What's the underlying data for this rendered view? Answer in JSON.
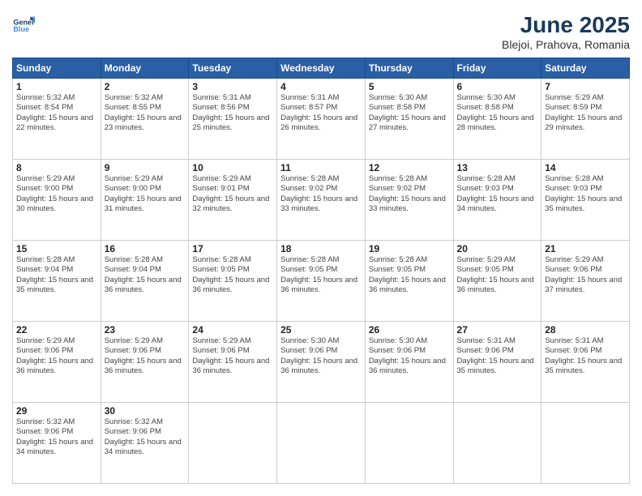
{
  "app": {
    "name": "GeneralBlue",
    "name_part1": "General",
    "name_part2": "Blue"
  },
  "header": {
    "month_year": "June 2025",
    "location": "Blejoi, Prahova, Romania"
  },
  "days_of_week": [
    "Sunday",
    "Monday",
    "Tuesday",
    "Wednesday",
    "Thursday",
    "Friday",
    "Saturday"
  ],
  "weeks": [
    [
      {
        "day": 1,
        "sunrise": "5:32 AM",
        "sunset": "8:54 PM",
        "daylight": "15 hours and 22 minutes."
      },
      {
        "day": 2,
        "sunrise": "5:32 AM",
        "sunset": "8:55 PM",
        "daylight": "15 hours and 23 minutes."
      },
      {
        "day": 3,
        "sunrise": "5:31 AM",
        "sunset": "8:56 PM",
        "daylight": "15 hours and 25 minutes."
      },
      {
        "day": 4,
        "sunrise": "5:31 AM",
        "sunset": "8:57 PM",
        "daylight": "15 hours and 26 minutes."
      },
      {
        "day": 5,
        "sunrise": "5:30 AM",
        "sunset": "8:58 PM",
        "daylight": "15 hours and 27 minutes."
      },
      {
        "day": 6,
        "sunrise": "5:30 AM",
        "sunset": "8:58 PM",
        "daylight": "15 hours and 28 minutes."
      },
      {
        "day": 7,
        "sunrise": "5:29 AM",
        "sunset": "8:59 PM",
        "daylight": "15 hours and 29 minutes."
      }
    ],
    [
      {
        "day": 8,
        "sunrise": "5:29 AM",
        "sunset": "9:00 PM",
        "daylight": "15 hours and 30 minutes."
      },
      {
        "day": 9,
        "sunrise": "5:29 AM",
        "sunset": "9:00 PM",
        "daylight": "15 hours and 31 minutes."
      },
      {
        "day": 10,
        "sunrise": "5:29 AM",
        "sunset": "9:01 PM",
        "daylight": "15 hours and 32 minutes."
      },
      {
        "day": 11,
        "sunrise": "5:28 AM",
        "sunset": "9:02 PM",
        "daylight": "15 hours and 33 minutes."
      },
      {
        "day": 12,
        "sunrise": "5:28 AM",
        "sunset": "9:02 PM",
        "daylight": "15 hours and 33 minutes."
      },
      {
        "day": 13,
        "sunrise": "5:28 AM",
        "sunset": "9:03 PM",
        "daylight": "15 hours and 34 minutes."
      },
      {
        "day": 14,
        "sunrise": "5:28 AM",
        "sunset": "9:03 PM",
        "daylight": "15 hours and 35 minutes."
      }
    ],
    [
      {
        "day": 15,
        "sunrise": "5:28 AM",
        "sunset": "9:04 PM",
        "daylight": "15 hours and 35 minutes."
      },
      {
        "day": 16,
        "sunrise": "5:28 AM",
        "sunset": "9:04 PM",
        "daylight": "15 hours and 36 minutes."
      },
      {
        "day": 17,
        "sunrise": "5:28 AM",
        "sunset": "9:05 PM",
        "daylight": "15 hours and 36 minutes."
      },
      {
        "day": 18,
        "sunrise": "5:28 AM",
        "sunset": "9:05 PM",
        "daylight": "15 hours and 36 minutes."
      },
      {
        "day": 19,
        "sunrise": "5:28 AM",
        "sunset": "9:05 PM",
        "daylight": "15 hours and 36 minutes."
      },
      {
        "day": 20,
        "sunrise": "5:29 AM",
        "sunset": "9:05 PM",
        "daylight": "15 hours and 36 minutes."
      },
      {
        "day": 21,
        "sunrise": "5:29 AM",
        "sunset": "9:06 PM",
        "daylight": "15 hours and 37 minutes."
      }
    ],
    [
      {
        "day": 22,
        "sunrise": "5:29 AM",
        "sunset": "9:06 PM",
        "daylight": "15 hours and 36 minutes."
      },
      {
        "day": 23,
        "sunrise": "5:29 AM",
        "sunset": "9:06 PM",
        "daylight": "15 hours and 36 minutes."
      },
      {
        "day": 24,
        "sunrise": "5:29 AM",
        "sunset": "9:06 PM",
        "daylight": "15 hours and 36 minutes."
      },
      {
        "day": 25,
        "sunrise": "5:30 AM",
        "sunset": "9:06 PM",
        "daylight": "15 hours and 36 minutes."
      },
      {
        "day": 26,
        "sunrise": "5:30 AM",
        "sunset": "9:06 PM",
        "daylight": "15 hours and 36 minutes."
      },
      {
        "day": 27,
        "sunrise": "5:31 AM",
        "sunset": "9:06 PM",
        "daylight": "15 hours and 35 minutes."
      },
      {
        "day": 28,
        "sunrise": "5:31 AM",
        "sunset": "9:06 PM",
        "daylight": "15 hours and 35 minutes."
      }
    ],
    [
      {
        "day": 29,
        "sunrise": "5:32 AM",
        "sunset": "9:06 PM",
        "daylight": "15 hours and 34 minutes."
      },
      {
        "day": 30,
        "sunrise": "5:32 AM",
        "sunset": "9:06 PM",
        "daylight": "15 hours and 34 minutes."
      },
      null,
      null,
      null,
      null,
      null
    ]
  ]
}
